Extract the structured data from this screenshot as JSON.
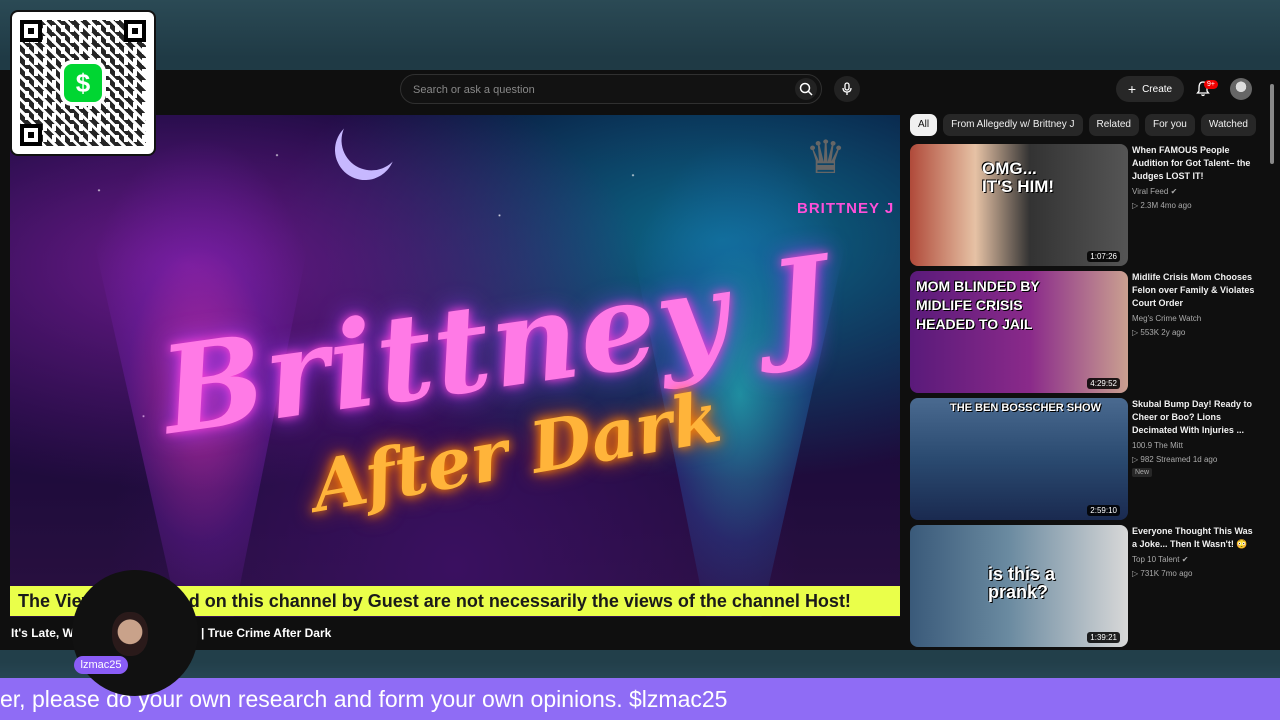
{
  "qr": {
    "cash_symbol": "$"
  },
  "search": {
    "placeholder": "Search or ask a question"
  },
  "header": {
    "create_label": "Create",
    "notification_count": "9+"
  },
  "player": {
    "title_line1": "Brittney J",
    "title_line2": "After Dark",
    "logo_text": "BRITTNEY J",
    "banner_text": "The Views expressed on this channel by Guest are not necessarily the views of the channel Host!"
  },
  "video": {
    "title": "It's Late, We Know He's Lying 👀 | True Crime After Dark"
  },
  "cam": {
    "label": "lzmac25"
  },
  "chips": [
    "All",
    "From Allegedly w/ Brittney J",
    "Related",
    "For you",
    "Watched"
  ],
  "recommendations": [
    {
      "title": "When FAMOUS People Audition for Got Talent– the Judges LOST IT!",
      "channel": "Viral Feed",
      "verified": true,
      "stats": "▷ 2.3M  4mo ago",
      "duration": "1:07:26",
      "thumb_text": "OMG... IT'S HIM!",
      "new": ""
    },
    {
      "title": "Midlife Crisis Mom Chooses Felon over Family & Violates Court Order",
      "channel": "Meg's Crime Watch",
      "verified": false,
      "stats": "▷ 553K  2y ago",
      "duration": "4:29:52",
      "thumb_text": "MOM BLINDED BY MIDLIFE CRISIS HEADED TO JAIL",
      "new": ""
    },
    {
      "title": "Skubal Bump Day! Ready to Cheer or Boo? Lions Decimated With Injuries ...",
      "channel": "100.9 The Mitt",
      "verified": false,
      "stats": "▷ 982  Streamed 1d ago",
      "duration": "2:59:10",
      "thumb_text": "THE BEN BOSSCHER SHOW",
      "new": "New"
    },
    {
      "title": "Everyone Thought This Was a Joke... Then It Wasn't! 😳",
      "channel": "Top 10 Talent",
      "verified": true,
      "stats": "▷ 731K  7mo ago",
      "duration": "1:39:21",
      "thumb_text": "is this a prank?",
      "new": ""
    }
  ],
  "ticker": {
    "text": "er, please do your own research and form your own opinions. $lzmac25"
  }
}
